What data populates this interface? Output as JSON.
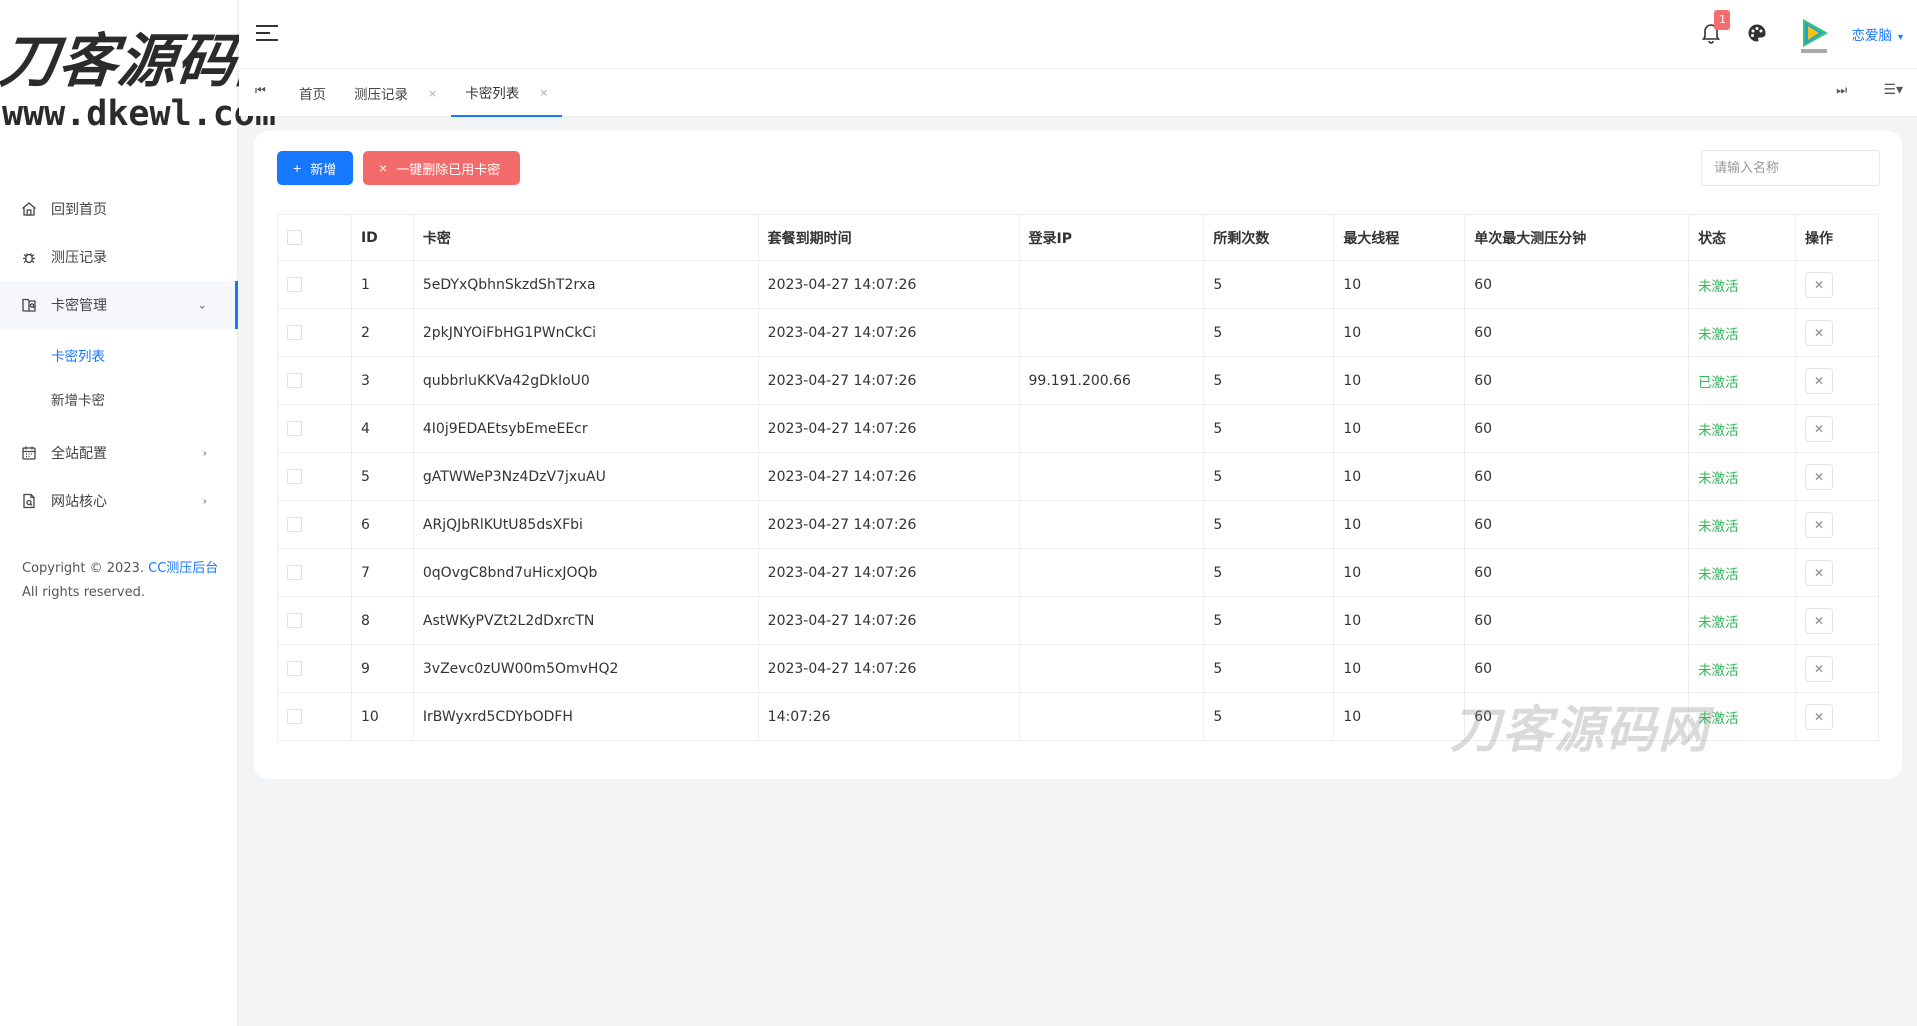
{
  "logo": {
    "cn": "刀客源码网",
    "en": "www.dkewl.com"
  },
  "sidebar": {
    "items": [
      {
        "label": "回到首页",
        "icon": "home-icon"
      },
      {
        "label": "测压记录",
        "icon": "bug-icon"
      },
      {
        "label": "卡密管理",
        "icon": "card-manage-icon",
        "arrow": "⌄",
        "children": [
          {
            "label": "卡密列表"
          },
          {
            "label": "新增卡密"
          }
        ]
      },
      {
        "label": "全站配置",
        "icon": "calendar-icon",
        "arrow": "›"
      },
      {
        "label": "网站核心",
        "icon": "document-icon",
        "arrow": "›"
      }
    ]
  },
  "copyright": {
    "prefix": "Copyright © 2023. ",
    "link": "CC测压后台",
    "line2": "All rights reserved."
  },
  "header": {
    "notification_count": "1",
    "username": "恋爱脑"
  },
  "tabs": [
    {
      "label": "首页"
    },
    {
      "label": "测压记录",
      "close": "×"
    },
    {
      "label": "卡密列表",
      "close": "×"
    }
  ],
  "toolbar": {
    "add_label": "新增",
    "delete_used_label": "一键删除已用卡密",
    "search_placeholder": "请输入名称"
  },
  "table": {
    "headers": [
      "ID",
      "卡密",
      "套餐到期时间",
      "登录IP",
      "所剩次数",
      "最大线程",
      "单次最大测压分钟",
      "状态",
      "操作"
    ],
    "rows": [
      {
        "id": "1",
        "key": "5eDYxQbhnSkzdShT2rxa",
        "expire": "2023-04-27 14:07:26",
        "ip": "",
        "remaining": "5",
        "threads": "10",
        "minutes": "60",
        "status": "未激活"
      },
      {
        "id": "2",
        "key": "2pkJNYOiFbHG1PWnCkCi",
        "expire": "2023-04-27 14:07:26",
        "ip": "",
        "remaining": "5",
        "threads": "10",
        "minutes": "60",
        "status": "未激活"
      },
      {
        "id": "3",
        "key": "qubbrluKKVa42gDkIoU0",
        "expire": "2023-04-27 14:07:26",
        "ip": "99.191.200.66",
        "remaining": "5",
        "threads": "10",
        "minutes": "60",
        "status": "已激活"
      },
      {
        "id": "4",
        "key": "4I0j9EDAEtsybEmeEEcr",
        "expire": "2023-04-27 14:07:26",
        "ip": "",
        "remaining": "5",
        "threads": "10",
        "minutes": "60",
        "status": "未激活"
      },
      {
        "id": "5",
        "key": "gATWWeP3Nz4DzV7jxuAU",
        "expire": "2023-04-27 14:07:26",
        "ip": "",
        "remaining": "5",
        "threads": "10",
        "minutes": "60",
        "status": "未激活"
      },
      {
        "id": "6",
        "key": "ARjQJbRlKUtU85dsXFbi",
        "expire": "2023-04-27 14:07:26",
        "ip": "",
        "remaining": "5",
        "threads": "10",
        "minutes": "60",
        "status": "未激活"
      },
      {
        "id": "7",
        "key": "0qOvgC8bnd7uHicxJOQb",
        "expire": "2023-04-27 14:07:26",
        "ip": "",
        "remaining": "5",
        "threads": "10",
        "minutes": "60",
        "status": "未激活"
      },
      {
        "id": "8",
        "key": "AstWKyPVZt2L2dDxrcTN",
        "expire": "2023-04-27 14:07:26",
        "ip": "",
        "remaining": "5",
        "threads": "10",
        "minutes": "60",
        "status": "未激活"
      },
      {
        "id": "9",
        "key": "3vZevc0zUW00m5OmvHQ2",
        "expire": "2023-04-27 14:07:26",
        "ip": "",
        "remaining": "5",
        "threads": "10",
        "minutes": "60",
        "status": "未激活"
      },
      {
        "id": "10",
        "key": "IrBWyxrd5CDYbODFH",
        "expire": "14:07:26",
        "ip": "",
        "remaining": "5",
        "threads": "10",
        "minutes": "60",
        "status": "未激活"
      }
    ]
  },
  "watermark": "刀客源码网",
  "colors": {
    "primary": "#1677ff",
    "danger": "#f26a6a",
    "success": "#2fb95a",
    "background": "#f3f4f6"
  }
}
